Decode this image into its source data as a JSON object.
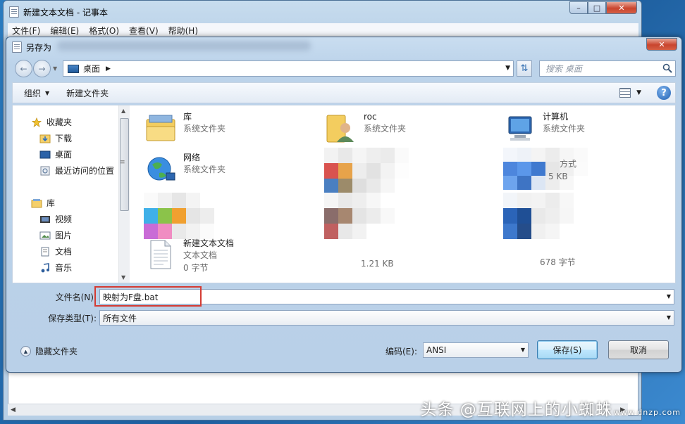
{
  "notepad": {
    "title": "新建文本文档 - 记事本",
    "menu": [
      "文件(F)",
      "编辑(E)",
      "格式(O)",
      "查看(V)",
      "帮助(H)"
    ]
  },
  "dialog": {
    "title": "另存为",
    "address": {
      "location": "桌面"
    },
    "search_placeholder": "搜索 桌面",
    "toolbar": {
      "organize": "组织",
      "new_folder": "新建文件夹"
    },
    "nav_pane": {
      "favorites_header": "收藏夹",
      "favorites": [
        "下载",
        "桌面",
        "最近访问的位置"
      ],
      "library_header": "库",
      "libraries": [
        "视频",
        "图片",
        "文档",
        "音乐"
      ]
    },
    "files": [
      {
        "name": "库",
        "type": "系统文件夹"
      },
      {
        "name": "roc",
        "type": "系统文件夹"
      },
      {
        "name": "计算机",
        "type": "系统文件夹"
      },
      {
        "name": "网络",
        "type": "系统文件夹"
      }
    ],
    "partial_files": {
      "f5_size": "5 KB",
      "f5_type_fragment": "方式",
      "f6_size": "1.21 KB",
      "f7_size": "678 字节"
    },
    "text_file": {
      "name": "新建文本文档",
      "type": "文本文档",
      "size": "0 字节"
    },
    "filename_label": "文件名(N):",
    "filename_value": "映射为F盘.bat",
    "filetype_label": "保存类型(T):",
    "filetype_value": "所有文件",
    "hide_folders_label": "隐藏文件夹",
    "encoding_label": "编码(E):",
    "encoding_value": "ANSI",
    "save_button": "保存(S)",
    "cancel_button": "取消"
  },
  "watermark": {
    "text": "头条 @互联网上的小蜘蛛",
    "site": "www.dnzp.com"
  },
  "colors": {
    "highlight_box": "#d43b33",
    "title_bar": "#bcd3ea",
    "accent": "#1f5fb1"
  }
}
